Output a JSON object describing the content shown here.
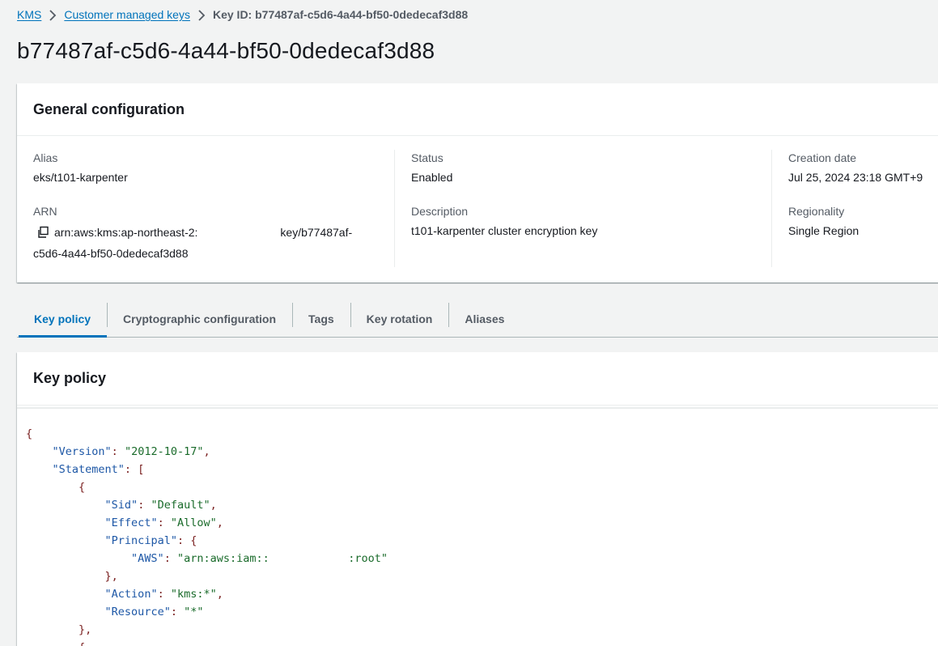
{
  "breadcrumb": {
    "items": [
      "KMS",
      "Customer managed keys"
    ],
    "current": "Key ID: b77487af-c5d6-4a44-bf50-0dedecaf3d88"
  },
  "page_title": "b77487af-c5d6-4a44-bf50-0dedecaf3d88",
  "general": {
    "title": "General configuration",
    "alias_label": "Alias",
    "alias_value": "eks/t101-karpenter",
    "arn_label": "ARN",
    "arn_part1": "arn:aws:kms:ap-northeast-2:",
    "arn_part2": "key/b77487af-",
    "arn_part3": "c5d6-4a44-bf50-0dedecaf3d88",
    "status_label": "Status",
    "status_value": "Enabled",
    "description_label": "Description",
    "description_value": "t101-karpenter cluster encryption key",
    "creation_label": "Creation date",
    "creation_value": "Jul 25, 2024 23:18 GMT+9",
    "regionality_label": "Regionality",
    "regionality_value": "Single Region"
  },
  "tabs": [
    "Key policy",
    "Cryptographic configuration",
    "Tags",
    "Key rotation",
    "Aliases"
  ],
  "active_tab": "Key policy",
  "policy": {
    "title": "Key policy",
    "lines": [
      {
        "indent": 0,
        "parts": [
          [
            "p",
            "{"
          ]
        ]
      },
      {
        "indent": 1,
        "parts": [
          [
            "k",
            "\"Version\""
          ],
          [
            "p",
            ": "
          ],
          [
            "s",
            "\"2012-10-17\""
          ],
          [
            "p",
            ","
          ]
        ]
      },
      {
        "indent": 1,
        "parts": [
          [
            "k",
            "\"Statement\""
          ],
          [
            "p",
            ": ["
          ]
        ]
      },
      {
        "indent": 2,
        "parts": [
          [
            "p",
            "{"
          ]
        ]
      },
      {
        "indent": 3,
        "parts": [
          [
            "k",
            "\"Sid\""
          ],
          [
            "p",
            ": "
          ],
          [
            "s",
            "\"Default\""
          ],
          [
            "p",
            ","
          ]
        ]
      },
      {
        "indent": 3,
        "parts": [
          [
            "k",
            "\"Effect\""
          ],
          [
            "p",
            ": "
          ],
          [
            "s",
            "\"Allow\""
          ],
          [
            "p",
            ","
          ]
        ]
      },
      {
        "indent": 3,
        "parts": [
          [
            "k",
            "\"Principal\""
          ],
          [
            "p",
            ": {"
          ]
        ]
      },
      {
        "indent": 4,
        "parts": [
          [
            "k",
            "\"AWS\""
          ],
          [
            "p",
            ": "
          ],
          [
            "s",
            "\"arn:aws:iam::            :root\""
          ]
        ]
      },
      {
        "indent": 3,
        "parts": [
          [
            "p",
            "},"
          ]
        ]
      },
      {
        "indent": 3,
        "parts": [
          [
            "k",
            "\"Action\""
          ],
          [
            "p",
            ": "
          ],
          [
            "s",
            "\"kms:*\""
          ],
          [
            "p",
            ","
          ]
        ]
      },
      {
        "indent": 3,
        "parts": [
          [
            "k",
            "\"Resource\""
          ],
          [
            "p",
            ": "
          ],
          [
            "s",
            "\"*\""
          ]
        ]
      },
      {
        "indent": 2,
        "parts": [
          [
            "p",
            "},"
          ]
        ]
      },
      {
        "indent": 2,
        "parts": [
          [
            "p",
            "{"
          ]
        ]
      }
    ]
  },
  "colors": {
    "link": "#0073bb",
    "background": "#f2f3f3",
    "json_key": "#1d57a6",
    "json_string": "#1a6b2b",
    "json_punct": "#7a1f1f"
  }
}
